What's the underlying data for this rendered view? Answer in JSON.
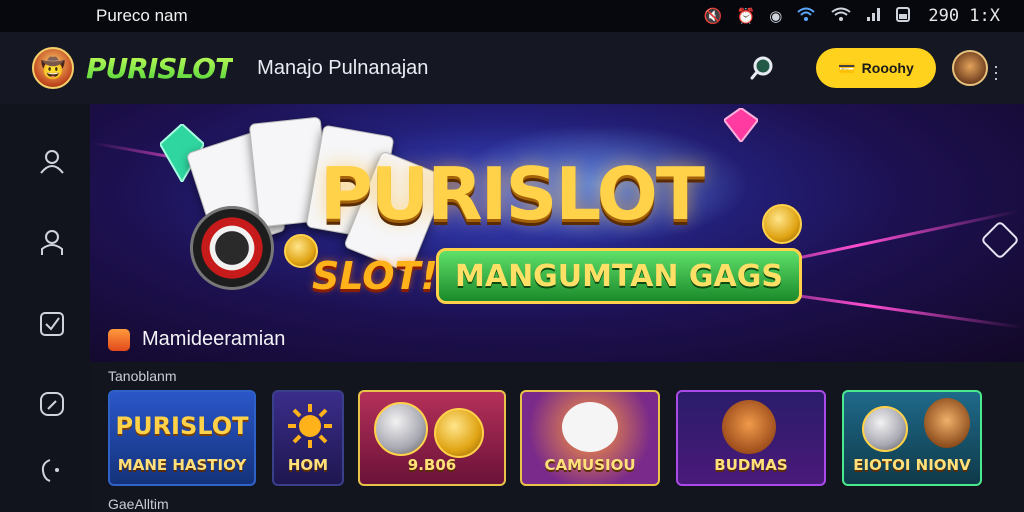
{
  "status_bar": {
    "title": "Pureco nam",
    "time": "290 1:X"
  },
  "app_bar": {
    "brand": "PURISLOT",
    "subtitle": "Manajo Pulnanajan",
    "cta_label": "Rooohy"
  },
  "hero": {
    "title": "PURISLOT",
    "slot_label": "SLOT!",
    "tag": "MANGUMTAN GAGS",
    "caption": "Mamideeramian"
  },
  "games_section": {
    "title": "Tanoblanm",
    "footer": "GaeAlltim",
    "tiles": [
      {
        "label": "MANE HASTIOY",
        "logo": "PURISLOT",
        "border": "#2f62c8"
      },
      {
        "label": "HOM",
        "border": "#3a3f8a"
      },
      {
        "label": "9.B06",
        "border": "#e9c24a"
      },
      {
        "label": "CAMUSIOU",
        "border": "#e9c24a"
      },
      {
        "label": "BUDMAS",
        "border": "#a94ae9"
      },
      {
        "label": "EIOTOI NIONV",
        "border": "#4ae98e"
      }
    ]
  },
  "colors": {
    "accent_yellow": "#ffd21e",
    "brand_green": "#4ad13a",
    "hero_purple": "#1d1050"
  }
}
